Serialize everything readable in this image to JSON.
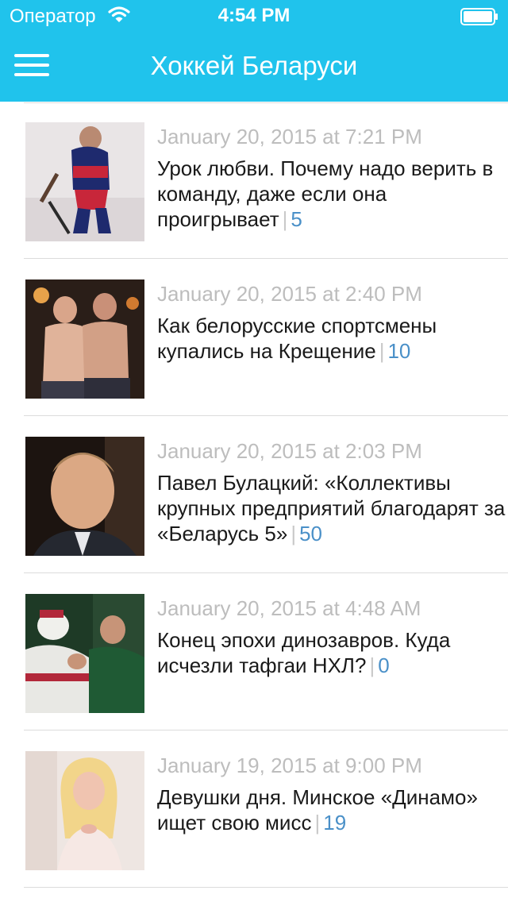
{
  "status_bar": {
    "carrier": "Оператор",
    "time": "4:54 PM"
  },
  "nav": {
    "title": "Хоккей Беларуси",
    "menu_icon": "hamburger-menu-icon"
  },
  "colors": {
    "header_bg": "#20c3ec",
    "date_text": "#bdbdbd",
    "comment_count": "#4a90c8"
  },
  "feed": [
    {
      "date": "January 20, 2015 at 7:21 PM",
      "title": "Урок любви. Почему надо верить в команду, даже если она проигрывает",
      "comments": "5",
      "image": "hockey-player-kneeling"
    },
    {
      "date": "January 20, 2015 at 2:40 PM",
      "title": "Как белорусские спортсмены купались на Крещение",
      "comments": "10",
      "image": "two-shirtless-men"
    },
    {
      "date": "January 20, 2015 at 2:03 PM",
      "title": "Павел Булацкий: «Коллективы крупных предприятий благодарят за «Беларусь 5»",
      "comments": "50",
      "image": "man-portrait"
    },
    {
      "date": "January 20, 2015 at 4:48 AM",
      "title": "Конец эпохи динозавров. Куда исчезли тафгаи НХЛ?",
      "comments": "0",
      "image": "hockey-fight"
    },
    {
      "date": "January 19, 2015 at 9:00 PM",
      "title": "Девушки дня. Минское «Динамо» ищет свою мисс",
      "comments": "19",
      "image": "blonde-woman"
    }
  ]
}
